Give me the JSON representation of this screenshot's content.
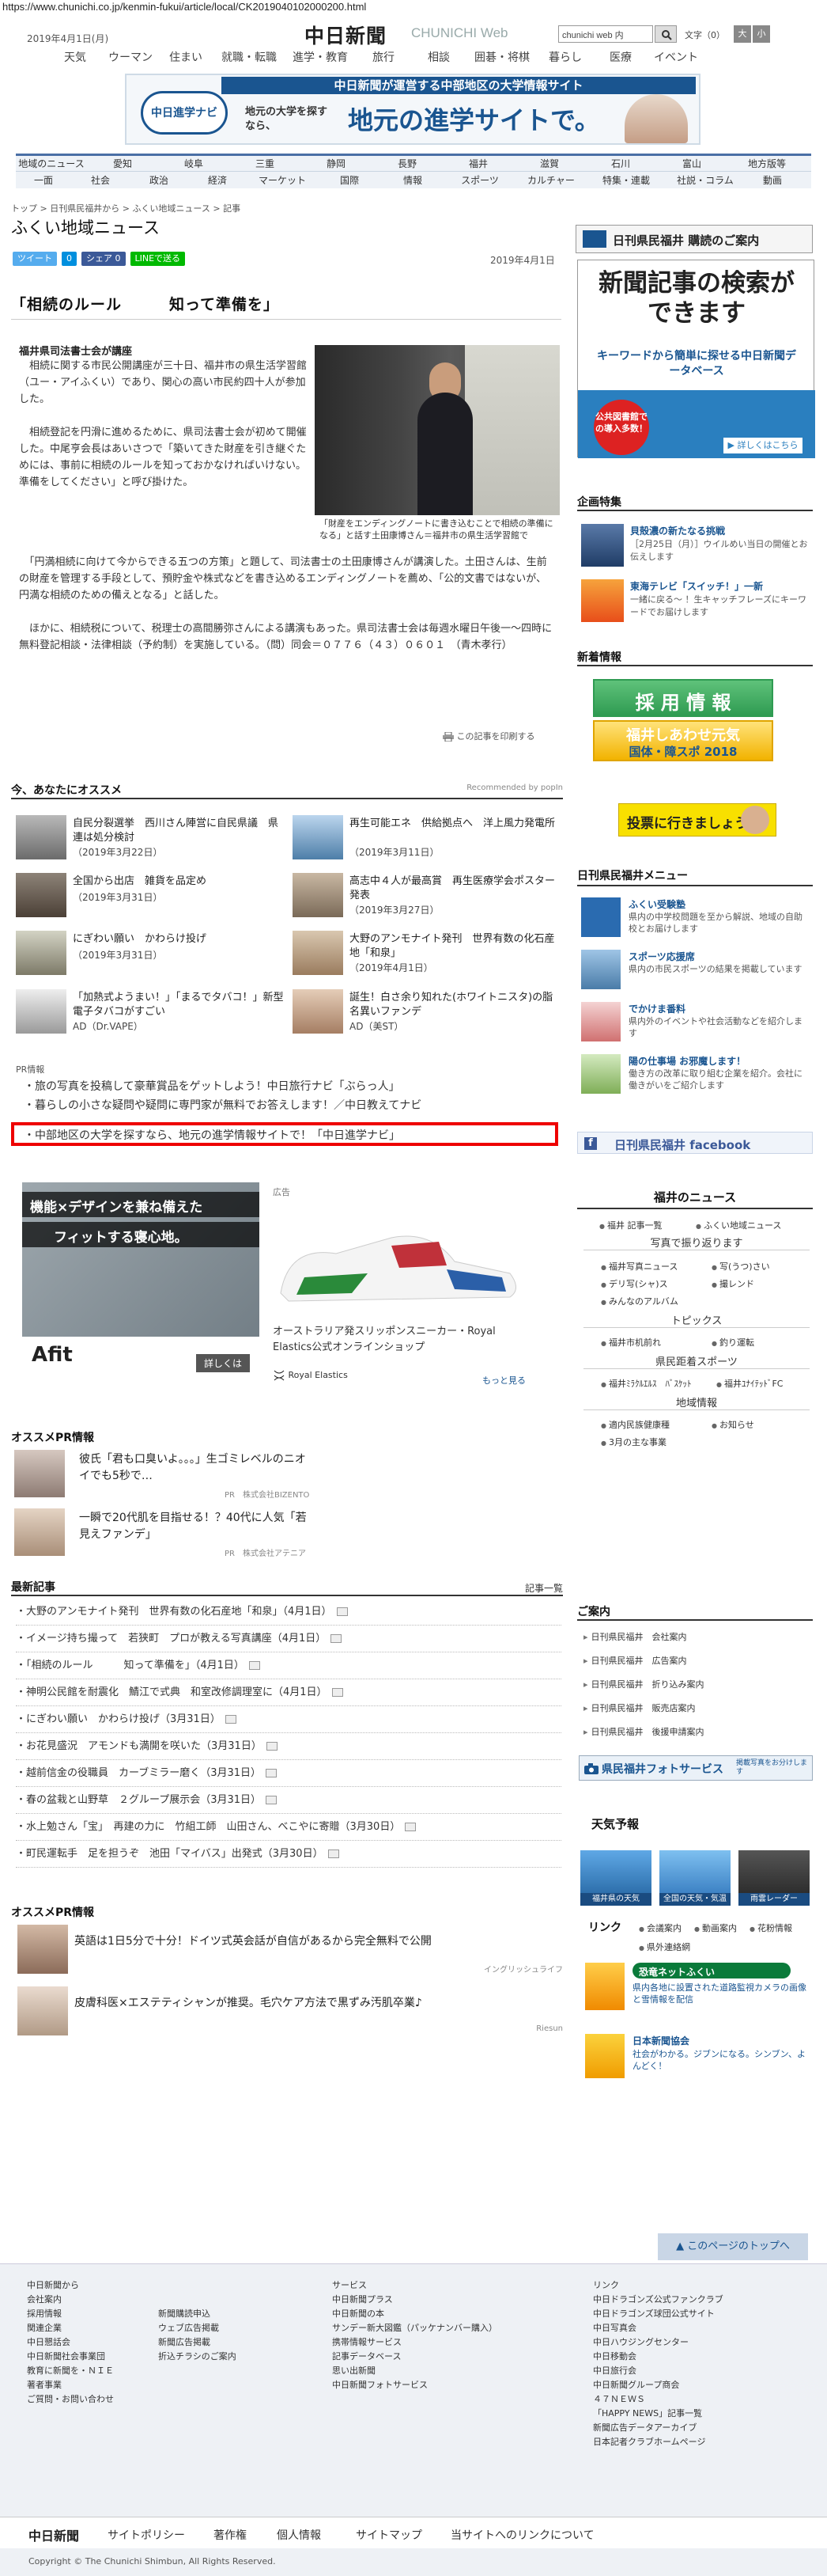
{
  "browser": {
    "url": "https://www.chunichi.co.jp/kenmin-fukui/article/local/CK2019040102000200.html"
  },
  "header": {
    "date": "2019年4月1日(月)",
    "logo": "中日新聞",
    "logo_en": "CHUNICHI Web",
    "search_value": "chunichi web 内",
    "font_label": "文字（0）",
    "font_large": "大",
    "font_small": "小"
  },
  "global_nav": [
    "天気",
    "ウーマン",
    "住まい",
    "就職・転職",
    "進学・教育",
    "旅行",
    "相談",
    "囲碁・将棋",
    "暮らし",
    "医療",
    "イベント"
  ],
  "banner": {
    "top": "中日新聞が運営する中部地区の大学情報サイト",
    "logo": "中日進学ナビ",
    "small": "地元の大学を探すなら、",
    "big": "地元の進学サイトで。"
  },
  "section_nav": {
    "row1": [
      "地域のニュース",
      "愛知",
      "岐阜",
      "三重",
      "静岡",
      "長野",
      "福井",
      "滋賀",
      "石川",
      "富山",
      "地方版等"
    ],
    "row2": [
      "一面",
      "社会",
      "政治",
      "経済",
      "マーケット",
      "国際",
      "情報",
      "スポーツ",
      "カルチャー",
      "特集・連載",
      "社説・コラム",
      "動画"
    ]
  },
  "breadcrumb": "トップ > 日刊県民福井から > ふくい地域ニュース > 記事",
  "page_title": "ふくい地域ニュース",
  "share": {
    "tweet": "ツイート",
    "hatena": "0",
    "fb": "シェア 0",
    "line": "LINEで送る"
  },
  "article": {
    "date": "2019年4月1日",
    "headline": "「相続のルール　　　知って準備を」",
    "byline": "福井県司法書士会が講座",
    "p1": "　相続に関する市民公開講座が三十日、福井市の県生活学習館（ユー・アイふくい）であり、関心の高い市民約四十人が参加した。",
    "p2": "　相続登記を円滑に進めるために、県司法書士会が初めて開催した。中尾亨会長はあいさつで「築いてきた財産を引き継ぐためには、事前に相続のルールを知っておかなければいけない。準備をしてください」と呼び掛けた。",
    "p3": "　「円満相続に向けて今からできる五つの方策」と題して、司法書士の土田康博さんが講演した。土田さんは、生前の財産を管理する手段として、預貯金や株式などを書き込めるエンディングノートを薦め、「公的文書ではないが、円満な相続のための備えとなる」と話した。",
    "p4": "　ほかに、相続税について、税理士の高間勝弥さんによる講演もあった。県司法書士会は毎週水曜日午後一～四時に無料登記相談・法律相談（予約制）を実施している。（問）同会＝０７７６（４３）０６０１　（青木孝行）",
    "caption": "「財産をエンディングノートに書き込むことで相続の準備になる」と話す土田康博さん＝福井市の県生活学習館で",
    "print": "この記事を印刷する"
  },
  "recommend": {
    "title": "今、あなたにオススメ",
    "by": "Recommended by  popIn",
    "items": [
      {
        "title": "自民分裂選挙　西川さん陣営に自民県議　県連は処分検討",
        "date": "（2019年3月22日）"
      },
      {
        "title": "再生可能エネ　供給拠点へ　洋上風力発電所",
        "date": "（2019年3月11日）"
      },
      {
        "title": "全国から出店　雑貨を品定め",
        "date": "（2019年3月31日）"
      },
      {
        "title": "高志中４人が最高賞　再生医療学会ポスター発表",
        "date": "（2019年3月27日）"
      },
      {
        "title": "にぎわい願い　かわらけ投げ",
        "date": "（2019年3月31日）"
      },
      {
        "title": "大野のアンモナイト発刊　世界有数の化石産地「和泉」",
        "date": "（2019年4月1日）"
      },
      {
        "title": "「加熱式ようまい！」「まるでタバコ！」新型電子タバコがすごい",
        "date": "AD（Dr.VAPE）"
      },
      {
        "title": "誕生！白さ余り知れた(ホワイトニスタ)の脂名異いファンデ",
        "date": "AD（美ST）"
      }
    ]
  },
  "pr_list": {
    "label": "PR情報",
    "items": [
      "旅の写真を投稿して豪華賞品をゲットしよう！中日旅行ナビ「ぶらっ人」",
      "暮らしの小さな疑問や疑問に専門家が無料でお答えします！／中日教えてナビ",
      "中部地区の大学を探すなら、地元の進学情報サイトで！「中日進学ナビ」"
    ]
  },
  "ad_left": {
    "line1": "機能×デザインを兼ね備えた",
    "line2": "フィットする寝心地。",
    "brand": "Afit",
    "more": "詳しくは"
  },
  "ad_right": {
    "label": "広告",
    "title": "オーストラリア発スリッポンスニーカー・Royal Elastics公式オンラインショップ",
    "brand": "Royal Elastics",
    "more": "もっと見る"
  },
  "osusume": {
    "title": "オススメPR情報",
    "items": [
      {
        "title": "彼氏「君も口臭いよ。。。」生ゴミレベルのニオイでも5秒で…",
        "pr": "PR　株式会社BIZENTO"
      },
      {
        "title": "一瞬で20代肌を目指せる！？40代に人気「若見えファンデ」",
        "pr": "PR　株式会社アテニア"
      }
    ]
  },
  "recent": {
    "title": "最新記事",
    "more": "記事一覧",
    "items": [
      "大野のアンモナイト発刊　世界有数の化石産地「和泉」（4月1日）",
      "イメージ持ち撮って　若狭町　プロが教える写真講座（4月1日）",
      "「相続のルール　　　知って準備を」（4月1日）",
      "神明公民館を耐震化　鯖江で式典　和室改修調理室に（4月1日）",
      "にぎわい願い　かわらけ投げ（3月31日）",
      "お花見盛況　アモンドも満開を咲いた（3月31日）",
      "越前信金の役職員　カーブミラー磨く（3月31日）",
      "春の盆栽と山野草　２グループ展示会（3月31日）",
      "水上勉さん「宝」　再建の力に　竹組工師　山田さん、べこやに寄贈（3月30日）",
      "町民運転手　足を担うぞ　池田「マイバス」出発式（3月30日）"
    ]
  },
  "bottom_pr": {
    "title": "オススメPR情報",
    "items": [
      {
        "title": "英語は1日5分で十分！ドイツ式英会話が自信があるから完全無料で公開",
        "src": "イングリッシュライフ"
      },
      {
        "title": "皮膚科医×エステティシャンが推奨。毛穴ケア方法で黒ずみ汚肌卒業♪",
        "src": "Riesun"
      }
    ]
  },
  "right": {
    "subscribe": "日刊県民福井 購読のご案内",
    "bigad": {
      "h": "新聞記事の検索ができます",
      "s": "キーワードから簡単に探せる中日新聞データベース",
      "c": "公共図書館での導入多数！",
      "m": "▶ 詳しくはこちら"
    },
    "kikaku_title": "企画特集",
    "kikaku": [
      {
        "title": "貝殻濃の新たなる挑戦",
        "desc": "［2月25日（月）］ウイルめい当日の開催とお伝えします"
      },
      {
        "title": "東海テレビ「スイッチ！」一新",
        "desc": "一緒に戻る～ ！生キャッチフレーズにキーワードでお届けします"
      }
    ],
    "shinchaku_title": "新着情報",
    "sky1": {
      "a": "採 用 情 報"
    },
    "sky2": {
      "a": "福井しあわせ元気",
      "b": "国体・障スポ 2018"
    },
    "ad2": "投票に行きましょう！",
    "menu_title": "日刊県民福井メニュー",
    "menu": [
      {
        "title": "ふくい受験塾",
        "desc": "県内の中学校問題を至から解説、地域の自助校とお届けします"
      },
      {
        "title": "スポーツ応援席",
        "desc": "県内の市民スポーツの結果を掲載しています"
      },
      {
        "title": "でかけま番料",
        "desc": "県内外のイベントや社会活動などを紹介します"
      },
      {
        "title": "陽の仕事場 お邪魔します！",
        "desc": "働き方の改革に取り組む企業を紹介。会社に働きがいをご紹介します"
      }
    ],
    "facebook": "日刊県民福井 facebook",
    "fnews_title": "福井のニュース",
    "tags1": [
      "福井 記事一覧",
      "ふくい地域ニュース"
    ],
    "tag_sub1": "写真で振り返ります",
    "tags2": [
      "福井写真ニュース",
      "写(うつ)さい",
      "デリ写(シャ)ス",
      "撮レンド",
      "みんなのアルバム"
    ],
    "tag_sub2": "トピックス",
    "tags3": [
      "福井市机前れ",
      "釣り運転"
    ],
    "tag_sub3": "県民距着スポーツ",
    "tags4": [
      "福井ﾐﾗｸﾙｴﾙｽ　ﾊﾞｽｹｯﾄ",
      "福井ﾕﾅｲﾃｯﾄﾞFC"
    ],
    "tag_sub4": "地域情報",
    "tags5": [
      "適内民族健康種",
      "お知らせ",
      "3月の主な事業"
    ],
    "annai_title": "ご案内",
    "annai": [
      "日刊県民福井　会社案内",
      "日刊県民福井　広告案内",
      "日刊県民福井　折り込み案内",
      "日刊県民福井　販売店案内",
      "日刊県民福井　後援申請案内"
    ],
    "photosvc": {
      "t": "県民福井フォトサービス",
      "s": "掲載写真をお分けします"
    },
    "weather_title": "天気予報",
    "weather": [
      "福井県の天気",
      "全国の天気・気温",
      "雨雲レーダー"
    ],
    "link_title": "リンク",
    "links": [
      "会議案内",
      "動画案内",
      "花粉情報",
      "県外連絡網"
    ],
    "link_ad": {
      "t": "恐竜ネットふくい",
      "d": "県内各地に設置された道路監視カメラの画像と雪情報を配信"
    },
    "shop": {
      "t": "日本新聞協会",
      "d": "社会がわかる。ジブンになる。シンブン、よんどく！"
    }
  },
  "totop": "▲ このページのトップへ",
  "footer": {
    "col1": [
      "中日新聞から",
      "会社案内",
      "採用情報",
      "関連企業",
      "中日懇話会",
      "中日新聞社会事業団",
      "教育に新聞を・ＮＩＥ",
      "著者事業",
      "ご質問・お問い合わせ"
    ],
    "col2": [
      "新聞購読申込",
      "ウェブ広告掲載",
      "新聞広告掲載",
      "折込チラシのご案内"
    ],
    "col3_title": "サービス",
    "col3": [
      "中日新聞プラス",
      "中日新聞の本",
      "サンデー新大図鑑（パッケナンバー購入）",
      "携帯情報サービス",
      "記事データベース",
      "思い出新聞",
      "中日新聞フォトサービス"
    ],
    "col4_title": "リンク",
    "col4": [
      "中日ドラゴンズ公式ファンクラブ",
      "中日ドラゴンズ球団公式サイト",
      "中日写真会",
      "中日ハウジングセンター",
      "中日移動会",
      "中日旅行会",
      "中日新聞グループ商会",
      "４７ＮＥＷＳ",
      "「HAPPY NEWS」記事一覧",
      "新聞広告データアーカイブ",
      "日本記者クラブホームページ"
    ]
  },
  "footer_bar": {
    "logo": "中日新聞",
    "links": [
      "サイトポリシー",
      "著作権",
      "個人情報",
      "サイトマップ",
      "当サイトへのリンクについて"
    ]
  },
  "copyright": "Copyright © The Chunichi Shimbun, All Rights Reserved."
}
